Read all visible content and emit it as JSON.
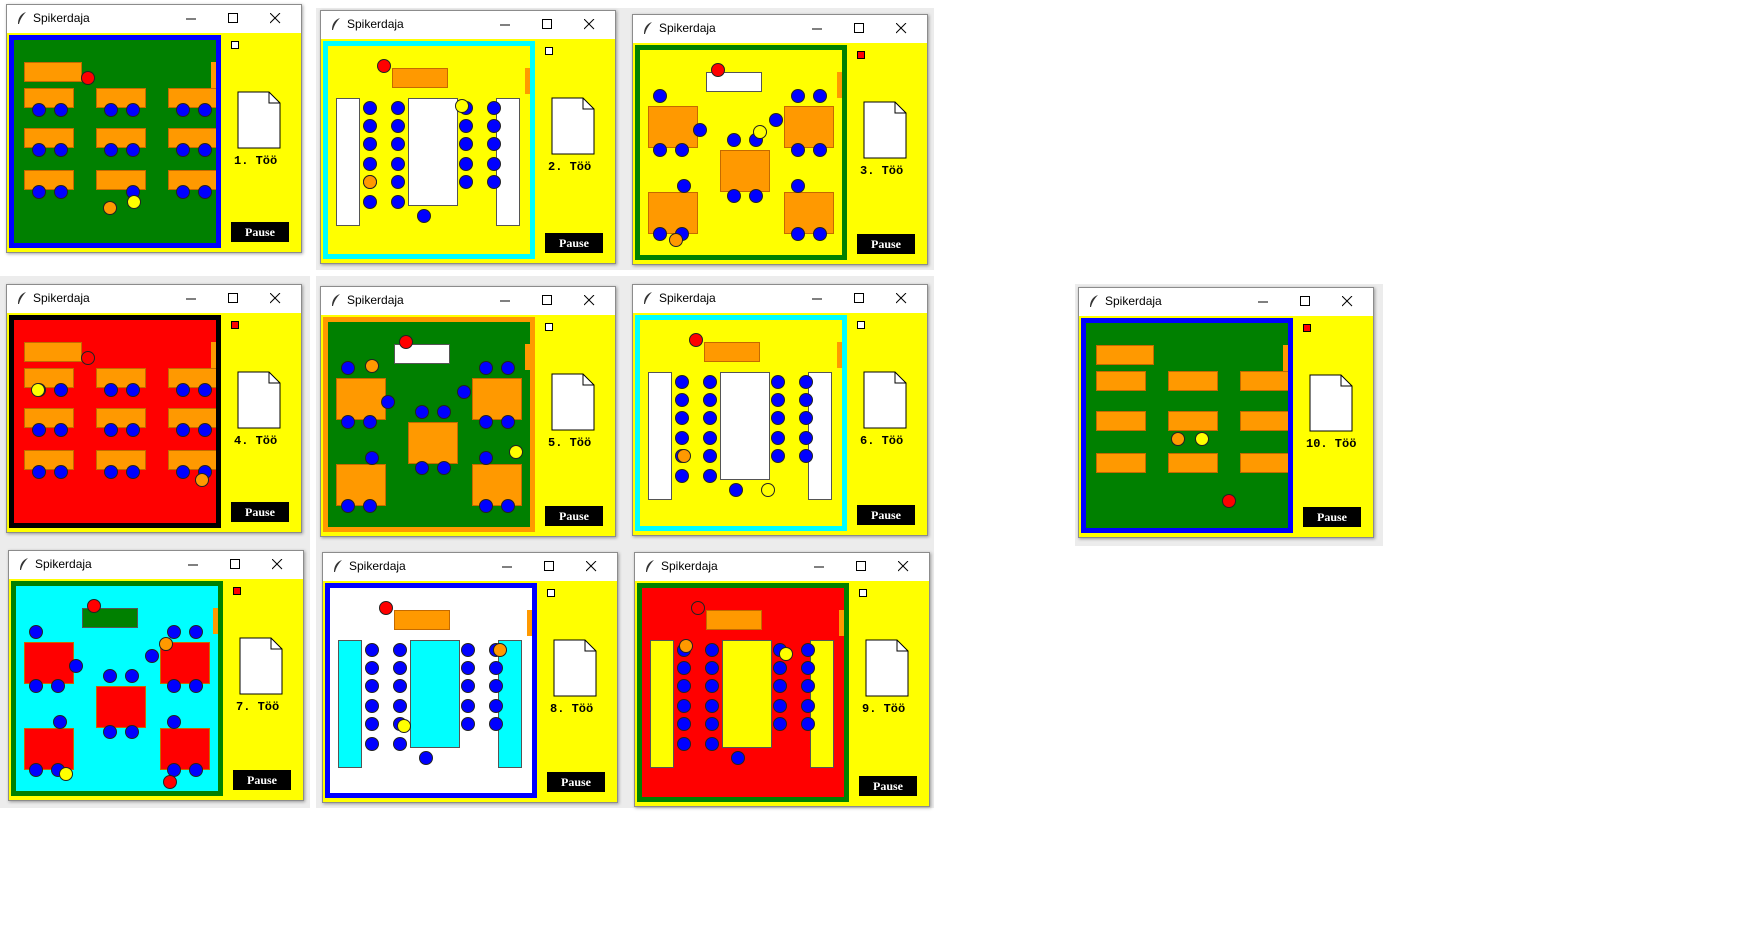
{
  "app_title": "Spikerdaja",
  "pause_label": "Pause",
  "colors": {
    "red": "#ff0000",
    "green": "#008000",
    "blue": "#0000ff",
    "yellow": "#ffff00",
    "cyan": "#00ffff",
    "orange": "#ff9900",
    "white": "#ffffff"
  },
  "windows": [
    {
      "task_label": "1. Töö",
      "flag_active": false,
      "layout": "grid",
      "floor": "#008000",
      "border": "#0000ff"
    },
    {
      "task_label": "2. Töö",
      "flag_active": false,
      "layout": "columns",
      "floor": "#ffff00",
      "border": "#00ffff"
    },
    {
      "task_label": "3. Töö",
      "flag_active": true,
      "layout": "islands",
      "floor": "#ffff00",
      "border": "#008000"
    },
    {
      "task_label": "4. Töö",
      "flag_active": true,
      "layout": "grid",
      "floor": "#ff0000",
      "border": "#000000"
    },
    {
      "task_label": "5. Töö",
      "flag_active": false,
      "layout": "islands",
      "floor": "#008000",
      "border": "#ff9900"
    },
    {
      "task_label": "6. Töö",
      "flag_active": false,
      "layout": "columns",
      "floor": "#ffff00",
      "border": "#00ffff"
    },
    {
      "task_label": "7. Töö",
      "flag_active": true,
      "layout": "islands",
      "floor": "#00ffff",
      "border": "#008000"
    },
    {
      "task_label": "8. Töö",
      "flag_active": false,
      "layout": "columns",
      "floor": "#ffffff",
      "border": "#0000ff"
    },
    {
      "task_label": "9. Töö",
      "flag_active": false,
      "layout": "columns",
      "floor": "#ff0000",
      "border": "#008000"
    },
    {
      "task_label": "10. Töö",
      "flag_active": true,
      "layout": "grid",
      "floor": "#008000",
      "border": "#0000ff"
    }
  ],
  "icons": [
    "feather-icon",
    "minimize-icon",
    "maximize-icon",
    "close-icon",
    "document-icon"
  ]
}
